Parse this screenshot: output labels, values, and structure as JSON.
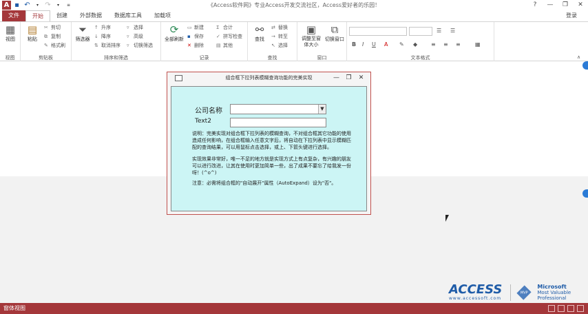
{
  "window": {
    "title": "《Access软件网》专业Access开发交流社区，Access爱好者的乐园！",
    "app_icon": "A",
    "controls": [
      "?",
      "—",
      "❐",
      "✕"
    ]
  },
  "tabs": [
    {
      "label": "文件"
    },
    {
      "label": "开始"
    },
    {
      "label": "创建"
    },
    {
      "label": "外部数据"
    },
    {
      "label": "数据库工具"
    },
    {
      "label": "加载项"
    }
  ],
  "login_label": "登录",
  "ribbon": {
    "view": {
      "label": "视图",
      "group": "视图"
    },
    "clipboard": {
      "paste": "粘贴",
      "cut": "剪切",
      "copy": "复制",
      "format_painter": "格式刷",
      "group": "剪贴板"
    },
    "sort_filter": {
      "filter": "筛选器",
      "ascending": "升序",
      "descending": "降序",
      "remove_sort": "取消排序",
      "selection": "选择",
      "advanced": "高级",
      "toggle_filter": "切换筛选",
      "group": "排序和筛选"
    },
    "records": {
      "refresh_all": "全部刷新",
      "new": "新建",
      "save": "保存",
      "delete": "删除",
      "totals": "合计",
      "spelling": "拼写检查",
      "more": "其他",
      "group": "记录"
    },
    "find": {
      "find": "查找",
      "replace": "替换",
      "goto": "转至",
      "select": "选择",
      "group": "查找"
    },
    "window": {
      "size_to_fit": "调整至窗体大小",
      "switch_windows": "切换窗口",
      "group": "窗口"
    },
    "text_format": {
      "group": "文本格式"
    }
  },
  "dialog": {
    "title": "组合框下拉列表模糊查询功能的完美实现",
    "controls": [
      "—",
      "❐",
      "✕"
    ],
    "company_label": "公司名称",
    "company_value": "",
    "text2_label": "Text2",
    "text2_value": "",
    "note1": "说明：完美实现对组合框下拉列表的模糊查询，不对组合框其它功能的使用造成任何影响，在组合框输入任意文字后，将自动在下拉列表中显示模糊匹配的查询结果，可以用鼠标点击选择，或上、下箭头键进行选择。",
    "note2": "实现效果非常好，唯一不足的地方就是实现方式上有点复杂，有兴趣的朋友可以进行改进，让其在使用时更加简单一些，出了成果不要忘了给我发一份呀！(^o^)",
    "note3": "注意：必需将组合框的\"自动展开\"属性（AutoExpand）设为\"否\"。"
  },
  "watermark": {
    "access": "ACCESS",
    "access_url": "www.accessoft.com",
    "mvp_line1": "Microsoft",
    "mvp_line2": "Most Valuable",
    "mvp_line3": "Professional",
    "mvp_badge": "MVP"
  },
  "status": {
    "text": "窗体视图"
  },
  "colors": {
    "accent": "#a4373a",
    "form_bg": "#ccf5f5",
    "dialog_border": "#c0504d"
  }
}
